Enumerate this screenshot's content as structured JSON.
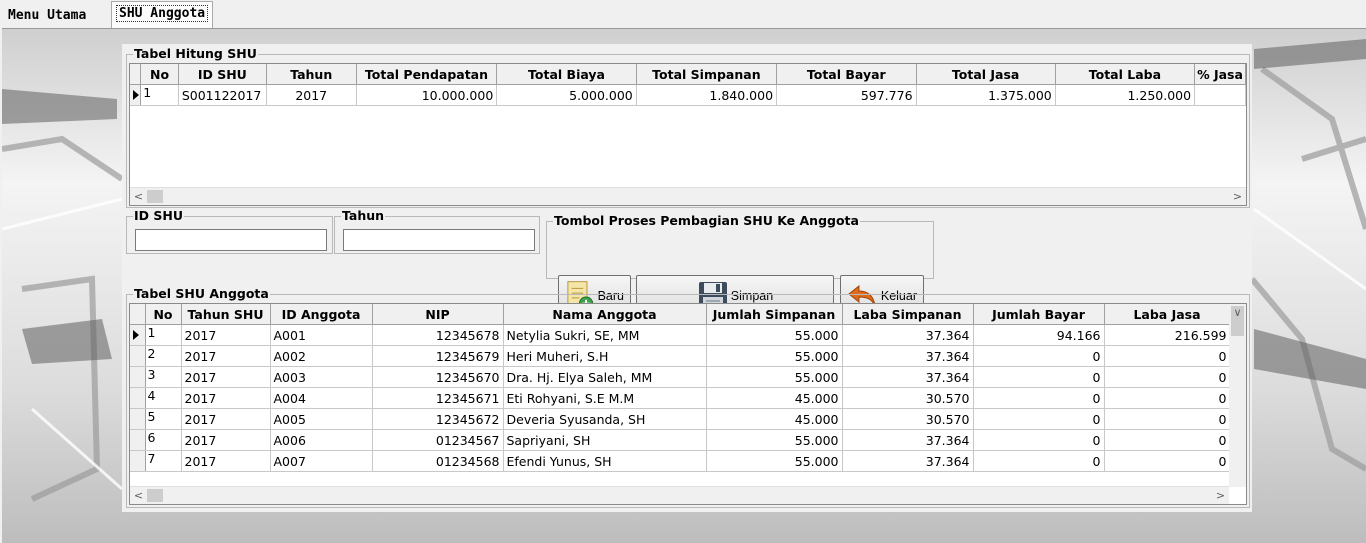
{
  "tabs": [
    {
      "label": "Menu Utama",
      "active": false
    },
    {
      "label": "SHU Anggota",
      "active": true
    }
  ],
  "shu_table": {
    "title": "Tabel Hitung SHU",
    "columns": [
      "No",
      "ID SHU",
      "Tahun",
      "Total Pendapatan",
      "Total Biaya",
      "Total Simpanan",
      "Total Bayar",
      "Total Jasa",
      "Total Laba",
      "% Jasa"
    ],
    "rows": [
      [
        "1",
        "S001122017",
        "2017",
        "10.000.000",
        "5.000.000",
        "1.840.000",
        "597.776",
        "1.375.000",
        "1.250.000",
        ""
      ]
    ]
  },
  "filters": {
    "id_shu": {
      "label": "ID SHU",
      "value": ""
    },
    "tahun": {
      "label": "Tahun",
      "value": ""
    }
  },
  "actions": {
    "title": "Tombol Proses Pembagian SHU Ke Anggota",
    "baru": "Baru",
    "simpan": "Simpan",
    "keluar": "Keluar"
  },
  "member_table": {
    "title": "Tabel SHU Anggota",
    "columns": [
      "No",
      "Tahun SHU",
      "ID Anggota",
      "NIP",
      "Nama Anggota",
      "Jumlah Simpanan",
      "Laba Simpanan",
      "Jumlah Bayar",
      "Laba Jasa"
    ],
    "rows": [
      [
        "1",
        "2017",
        "A001",
        "12345678",
        "Netylia Sukri, SE, MM",
        "55.000",
        "37.364",
        "94.166",
        "216.599"
      ],
      [
        "2",
        "2017",
        "A002",
        "12345679",
        "Heri Muheri, S.H",
        "55.000",
        "37.364",
        "0",
        "0"
      ],
      [
        "3",
        "2017",
        "A003",
        "12345670",
        "Dra. Hj. Elya Saleh, MM",
        "55.000",
        "37.364",
        "0",
        "0"
      ],
      [
        "4",
        "2017",
        "A004",
        "12345671",
        "Eti Rohyani, S.E M.M",
        "45.000",
        "30.570",
        "0",
        "0"
      ],
      [
        "5",
        "2017",
        "A005",
        "12345672",
        "Deveria Syusanda, SH",
        "45.000",
        "30.570",
        "0",
        "0"
      ],
      [
        "6",
        "2017",
        "A006",
        "01234567",
        "Sapriyani, SH",
        "55.000",
        "37.364",
        "0",
        "0"
      ],
      [
        "7",
        "2017",
        "A007",
        "01234568",
        "Efendi Yunus, SH",
        "55.000",
        "37.364",
        "0",
        "0"
      ]
    ]
  },
  "icons": {
    "baru": "new-document-icon",
    "simpan": "floppy-disk-icon",
    "keluar": "undo-arrow-icon"
  }
}
